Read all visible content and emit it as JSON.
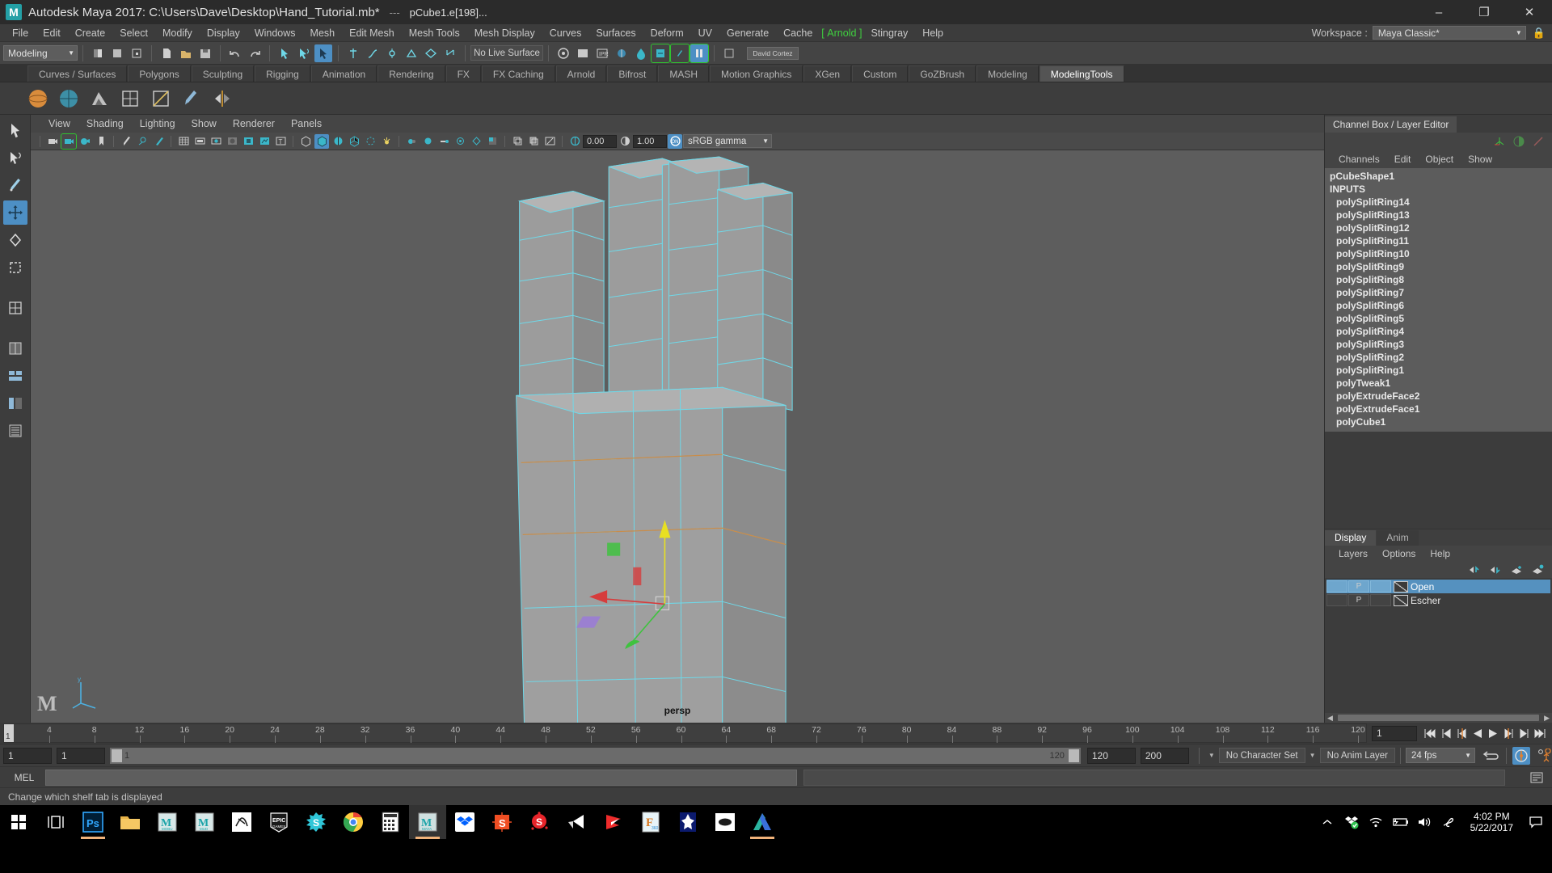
{
  "titlebar": {
    "app_title": "Autodesk Maya 2017: C:\\Users\\Dave\\Desktop\\Hand_Tutorial.mb*",
    "separator": "---",
    "selection": "pCube1.e[198]...",
    "minimize": "–",
    "maximize": "❐",
    "close": "✕"
  },
  "menubar": {
    "items": [
      "File",
      "Edit",
      "Create",
      "Select",
      "Modify",
      "Display",
      "Windows",
      "Mesh",
      "Edit Mesh",
      "Mesh Tools",
      "Mesh Display",
      "Curves",
      "Surfaces",
      "Deform",
      "UV",
      "Generate",
      "Cache",
      "Arnold",
      "Stingray",
      "Help"
    ],
    "arnold_item": "Arnold",
    "workspace_label": "Workspace :",
    "workspace_value": "Maya Classic*",
    "lock_icon": "lock-icon"
  },
  "statusline": {
    "mode_value": "Modeling",
    "no_live_surface": "No Live Surface",
    "user_tag": "David Cortez",
    "icons": [
      "select-by-hierarchy-icon",
      "select-by-object-icon",
      "select-by-component-icon",
      "new-scene-icon",
      "open-scene-icon",
      "save-scene-icon",
      "undo-icon",
      "redo-icon",
      "select-tool-icon",
      "lasso-tool-icon",
      "paint-select-icon",
      "move-tool-icon",
      "rotate-tool-icon",
      "scale-tool-icon",
      "snap-grid-icon",
      "snap-curve-icon",
      "snap-point-icon",
      "snap-projected-icon",
      "snap-view-plane-icon",
      "render-current-frame-icon",
      "ipr-render-icon",
      "render-settings-icon",
      "hypershade-icon",
      "outliner-icon",
      "node-editor-icon",
      "attribute-editor-icon",
      "tool-settings-icon",
      "channel-box-icon",
      "pause-icon"
    ]
  },
  "shelf": {
    "tabs": [
      "Curves / Surfaces",
      "Polygons",
      "Sculpting",
      "Rigging",
      "Animation",
      "Rendering",
      "FX",
      "FX Caching",
      "Arnold",
      "Bifrost",
      "MASH",
      "Motion Graphics",
      "XGen",
      "Custom",
      "GoZBrush",
      "Modeling",
      "ModelingTools"
    ],
    "active_tab": "ModelingTools",
    "icons": [
      "sphere-smooth-icon",
      "sphere-wire-icon",
      "bevel-icon",
      "quad-draw-icon",
      "multi-cut-icon",
      "sculpt-brush-icon",
      "symmetry-icon"
    ]
  },
  "toolbox": {
    "tools": [
      "select-tool-icon",
      "lasso-select-tool-icon",
      "paint-select-tool-icon",
      "move-tool-icon",
      "rotate-tool-icon",
      "scale-tool-icon",
      "last-tool-icon",
      "single-pane-layout-icon",
      "two-pane-split-layout-icon",
      "multi-pane-layout-icon",
      "persp-outliner-layout-icon",
      "hypershade-persp-layout-icon"
    ],
    "selected_tool": "move-tool-icon"
  },
  "viewport": {
    "panel_menu": [
      "View",
      "Shading",
      "Lighting",
      "Show",
      "Renderer",
      "Panels"
    ],
    "camera_label": "persp",
    "exposure_value": "0.00",
    "gamma_value": "1.00",
    "color_management": "sRGB gamma",
    "toolbar_icons": [
      "select-camera-icon",
      "lock-camera-icon",
      "camera-attributes-icon",
      "bookmark-icon",
      "image-plane-icon",
      "grease-pencil-icon",
      "2d-pan-zoom-icon",
      "grid-icon",
      "film-gate-icon",
      "resolution-gate-icon",
      "gate-mask-icon",
      "field-chart-icon",
      "safe-action-icon",
      "safe-title-icon",
      "wireframe-icon",
      "smooth-shade-icon",
      "shaded-wireframe-icon",
      "textured-icon",
      "lighting-icon",
      "shadows-icon",
      "ao-icon",
      "aa-icon",
      "motion-blur-icon",
      "multisample-icon",
      "isolate-select-icon",
      "xray-icon",
      "xray-joints-icon",
      "xray-active-icon",
      "exposure-icon",
      "gamma-icon",
      "color-management-toggle-icon"
    ],
    "manipulator": "move-manipulator",
    "model": "low-poly-hand-mesh"
  },
  "channelbox": {
    "title": "Channel Box / Layer Editor",
    "menus": [
      "Channels",
      "Edit",
      "Object",
      "Show"
    ],
    "icons": [
      "channel-box-icon",
      "attribute-editor-icon",
      "modeling-toolkit-icon"
    ],
    "object_name": "pCubeShape1",
    "inputs_header": "INPUTS",
    "inputs": [
      "polySplitRing14",
      "polySplitRing13",
      "polySplitRing12",
      "polySplitRing11",
      "polySplitRing10",
      "polySplitRing9",
      "polySplitRing8",
      "polySplitRing7",
      "polySplitRing6",
      "polySplitRing5",
      "polySplitRing4",
      "polySplitRing3",
      "polySplitRing2",
      "polySplitRing1",
      "polyTweak1",
      "polyExtrudeFace2",
      "polyExtrudeFace1",
      "polyCube1"
    ]
  },
  "layereditor": {
    "tabs": [
      "Display",
      "Anim"
    ],
    "active_tab": "Display",
    "menus": [
      "Layers",
      "Options",
      "Help"
    ],
    "buttons": [
      "move-layer-up-icon",
      "move-layer-down-icon",
      "new-layer-icon",
      "new-layer-from-selected-icon"
    ],
    "layers": [
      {
        "visibility": "",
        "playback": "P",
        "state": "",
        "name": "Open",
        "selected": true
      },
      {
        "visibility": "",
        "playback": "P",
        "state": "",
        "name": "Escher",
        "selected": false
      }
    ]
  },
  "timeslider": {
    "current_frame": "1",
    "start_tick": 1,
    "end_tick": 120,
    "tick_labels": [
      4,
      8,
      12,
      16,
      20,
      24,
      28,
      32,
      36,
      40,
      44,
      48,
      52,
      56,
      60,
      64,
      68,
      72,
      76,
      80,
      84,
      88,
      92,
      96,
      100,
      104,
      108,
      112,
      116,
      120
    ],
    "frame_field": "1",
    "playback_buttons": [
      "go-to-start-icon",
      "step-back-key-icon",
      "step-back-frame-icon",
      "play-backwards-icon",
      "play-forwards-icon",
      "step-forward-frame-icon",
      "step-forward-key-icon",
      "go-to-end-icon"
    ]
  },
  "rangeslider": {
    "anim_start": "1",
    "range_start": "1",
    "slider_start_label": "1",
    "slider_end_label": "120",
    "range_end": "120",
    "anim_end": "200",
    "character_set": "No Character Set",
    "anim_layer": "No Anim Layer",
    "fps": "24 fps",
    "loop_icon": "loop-playback-icon",
    "auto_key_icon": "auto-keyframe-icon",
    "prefs_icon": "animation-preferences-icon"
  },
  "commandline": {
    "language": "MEL",
    "input_value": "",
    "result_value": "",
    "script_editor_icon": "script-editor-icon"
  },
  "helpline": {
    "message": "Change which shelf tab is displayed"
  },
  "taskbar": {
    "start_icon": "windows-start-icon",
    "task_view_icon": "task-view-icon",
    "apps": [
      {
        "name": "photoshop-icon",
        "label": "Ps",
        "running": true
      },
      {
        "name": "file-explorer-icon",
        "label": "",
        "running": false
      },
      {
        "name": "motionbuilder-icon",
        "label": "MOBU",
        "running": false
      },
      {
        "name": "mudbox-icon",
        "label": "MUD",
        "running": false
      },
      {
        "name": "mixamo-fuse-icon",
        "label": "",
        "running": false
      },
      {
        "name": "epic-games-icon",
        "label": "EPIC",
        "running": false
      },
      {
        "name": "substance-designer-icon",
        "label": "",
        "running": false
      },
      {
        "name": "google-chrome-icon",
        "label": "",
        "running": false
      },
      {
        "name": "calculator-icon",
        "label": "",
        "running": false
      },
      {
        "name": "maya-icon",
        "label": "MAYA",
        "running": true,
        "active": true
      },
      {
        "name": "dropbox-icon",
        "label": "",
        "running": false
      },
      {
        "name": "substance-painter-icon",
        "label": "",
        "running": false
      },
      {
        "name": "substance-icon",
        "label": "",
        "running": false
      },
      {
        "name": "unity-icon",
        "label": "",
        "running": false
      },
      {
        "name": "marmoset-toolbag-icon",
        "label": "",
        "running": false
      },
      {
        "name": "fusion-360-icon",
        "label": "360",
        "running": false
      },
      {
        "name": "topogun-icon",
        "label": "",
        "running": false
      },
      {
        "name": "oculus-icon",
        "label": "",
        "running": false
      },
      {
        "name": "autodesk-icon",
        "label": "",
        "running": true
      }
    ],
    "tray": {
      "show_hidden_icon": "chevron-up-icon",
      "dropbox_icon": "dropbox-tray-icon",
      "network_icon": "wifi-icon",
      "battery_icon": "battery-charging-icon",
      "volume_icon": "speaker-icon",
      "pen_icon": "pen-tray-icon",
      "time": "4:02 PM",
      "date": "5/22/2017",
      "notification_icon": "notification-center-icon"
    }
  },
  "colors": {
    "accent_blue": "#4d8fc4",
    "arnold_green": "#3fd03f",
    "viewport_bg": "#5d5d5d",
    "mesh_fill": "#9a9a9a",
    "wire_cyan": "#6fd8e8",
    "axis_red": "#d63c3c",
    "axis_green": "#3fc23f",
    "axis_yellow": "#e8e021",
    "panel_bg": "#444444"
  }
}
